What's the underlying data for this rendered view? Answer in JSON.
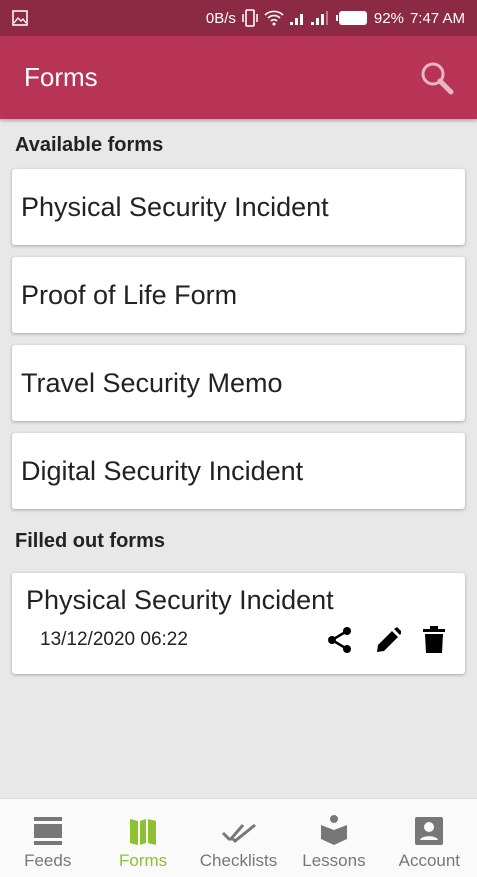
{
  "status": {
    "speed": "0B/s",
    "battery": "92%",
    "time": "7:47 AM"
  },
  "appbar": {
    "title": "Forms",
    "search_icon": "search-icon"
  },
  "available": {
    "heading": "Available forms",
    "items": [
      "Physical Security Incident",
      "Proof of Life Form",
      "Travel Security Memo",
      "Digital Security Incident"
    ]
  },
  "filled": {
    "heading": "Filled out forms",
    "items": [
      {
        "title": "Physical Security Incident",
        "date": "13/12/2020 06:22"
      }
    ]
  },
  "nav": {
    "active": "Forms",
    "active_color": "#8fc031",
    "items": [
      {
        "label": "Feeds",
        "icon": "feeds-icon"
      },
      {
        "label": "Forms",
        "icon": "map-icon"
      },
      {
        "label": "Checklists",
        "icon": "double-check-icon"
      },
      {
        "label": "Lessons",
        "icon": "reading-icon"
      },
      {
        "label": "Account",
        "icon": "account-icon"
      }
    ]
  }
}
